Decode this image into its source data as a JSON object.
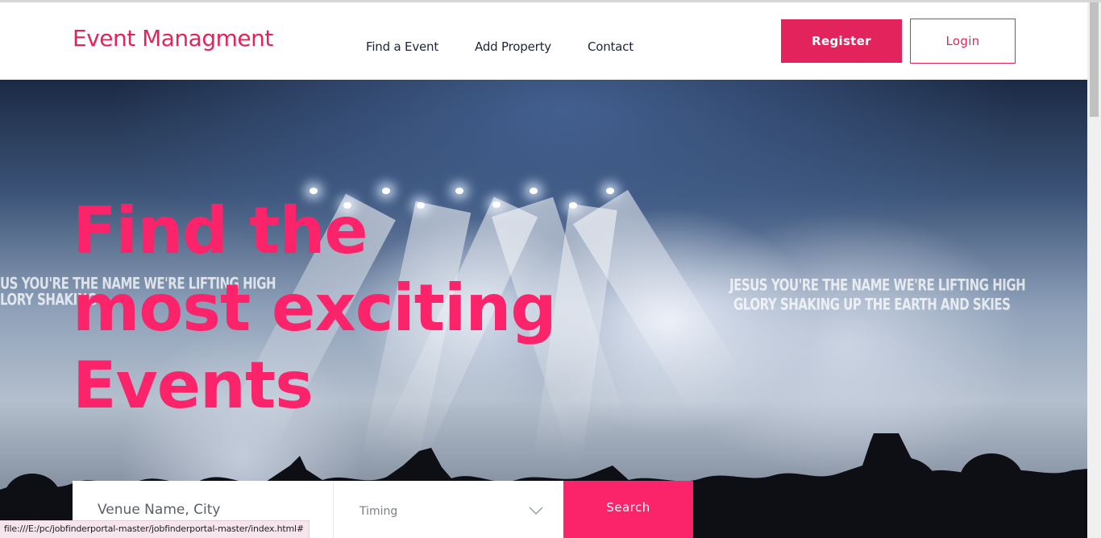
{
  "site": {
    "logo_text": "Event Managment",
    "accent_color": "#fb246a"
  },
  "nav": {
    "items": [
      {
        "label": "Find a Event"
      },
      {
        "label": "Add Property"
      },
      {
        "label": "Contact"
      }
    ]
  },
  "auth": {
    "register_label": "Register",
    "login_label": "Login"
  },
  "hero": {
    "headline_lines": [
      "Find the",
      "most exciting",
      "Events"
    ],
    "lyric_left_1": "US YOU'RE THE NAME WE'RE LIFTING HIGH",
    "lyric_left_2": "LORY SHAKING",
    "lyric_right_1": "JESUS YOU'RE THE NAME WE'RE LIFTING HIGH",
    "lyric_right_2": "GLORY SHAKING UP THE EARTH AND SKIES"
  },
  "search": {
    "venue_placeholder": "Venue Name, City",
    "timing_label": "Timing",
    "search_label": "Search"
  },
  "status_bar": {
    "url": "file:///E:/pc/jobfinderportal-master/jobfinderportal-master/index.html#"
  }
}
